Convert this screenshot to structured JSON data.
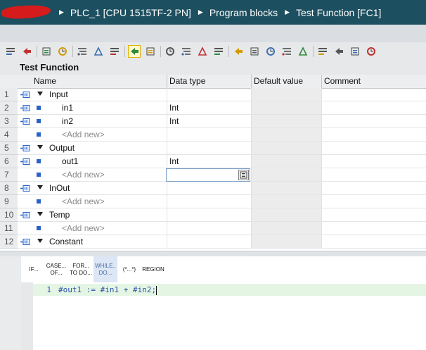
{
  "breadcrumb": {
    "items": [
      "PLC_1 [CPU 1515TF-2 PN]",
      "Program blocks",
      "Test Function [FC1]"
    ]
  },
  "toolbar": {
    "icons": [
      "insert-row-icon",
      "add-row-icon",
      "move-up-icon",
      "network-icon",
      "comments-icon",
      "view-icon",
      "interface-icon",
      "monitor-icon",
      "breakpoint-icon",
      "clear-breakpoint-icon",
      "disable-breakpoint-icon",
      "enable-breakpoint-icon",
      "favorites-icon",
      "go-to-icon",
      "indent-icon",
      "outdent-icon",
      "comment-line-icon",
      "uncomment-icon",
      "fold-icon",
      "watch-icon",
      "step-icon",
      "refresh-icon"
    ]
  },
  "block": {
    "title": "Test Function"
  },
  "table": {
    "headers": {
      "name": "Name",
      "type": "Data type",
      "default": "Default value",
      "comment": "Comment"
    },
    "rows": [
      {
        "num": "1",
        "kind": "section",
        "name": "Input",
        "type": ""
      },
      {
        "num": "2",
        "kind": "var",
        "name": "in1",
        "type": "Int"
      },
      {
        "num": "3",
        "kind": "var",
        "name": "in2",
        "type": "Int"
      },
      {
        "num": "4",
        "kind": "add",
        "name": "<Add new>",
        "type": ""
      },
      {
        "num": "5",
        "kind": "section",
        "name": "Output",
        "type": ""
      },
      {
        "num": "6",
        "kind": "var",
        "name": "out1",
        "type": "Int"
      },
      {
        "num": "7",
        "kind": "add",
        "name": "<Add new>",
        "type": "",
        "editing": true
      },
      {
        "num": "8",
        "kind": "section",
        "name": "InOut",
        "type": ""
      },
      {
        "num": "9",
        "kind": "add",
        "name": "<Add new>",
        "type": ""
      },
      {
        "num": "10",
        "kind": "section",
        "name": "Temp",
        "type": ""
      },
      {
        "num": "11",
        "kind": "add",
        "name": "<Add new>",
        "type": ""
      },
      {
        "num": "12",
        "kind": "section",
        "name": "Constant",
        "type": ""
      }
    ]
  },
  "keywords": [
    {
      "id": "if",
      "label": "IF...",
      "selected": false
    },
    {
      "id": "case",
      "label": "CASE... OF...",
      "selected": false
    },
    {
      "id": "for",
      "label": "FOR... TO DO...",
      "selected": false
    },
    {
      "id": "while",
      "label": "WHILE.. DO...",
      "selected": true
    },
    {
      "id": "comment",
      "label": "(*...*)",
      "selected": false
    },
    {
      "id": "region",
      "label": "REGION",
      "selected": false
    }
  ],
  "code": {
    "line_number": "1",
    "text": "#out1 := #in1 + #in2;"
  },
  "colors": {
    "crumb_bg": "#1c4f5f",
    "code_text": "#2b53a6",
    "code_line_bg": "#e4f5e4"
  }
}
